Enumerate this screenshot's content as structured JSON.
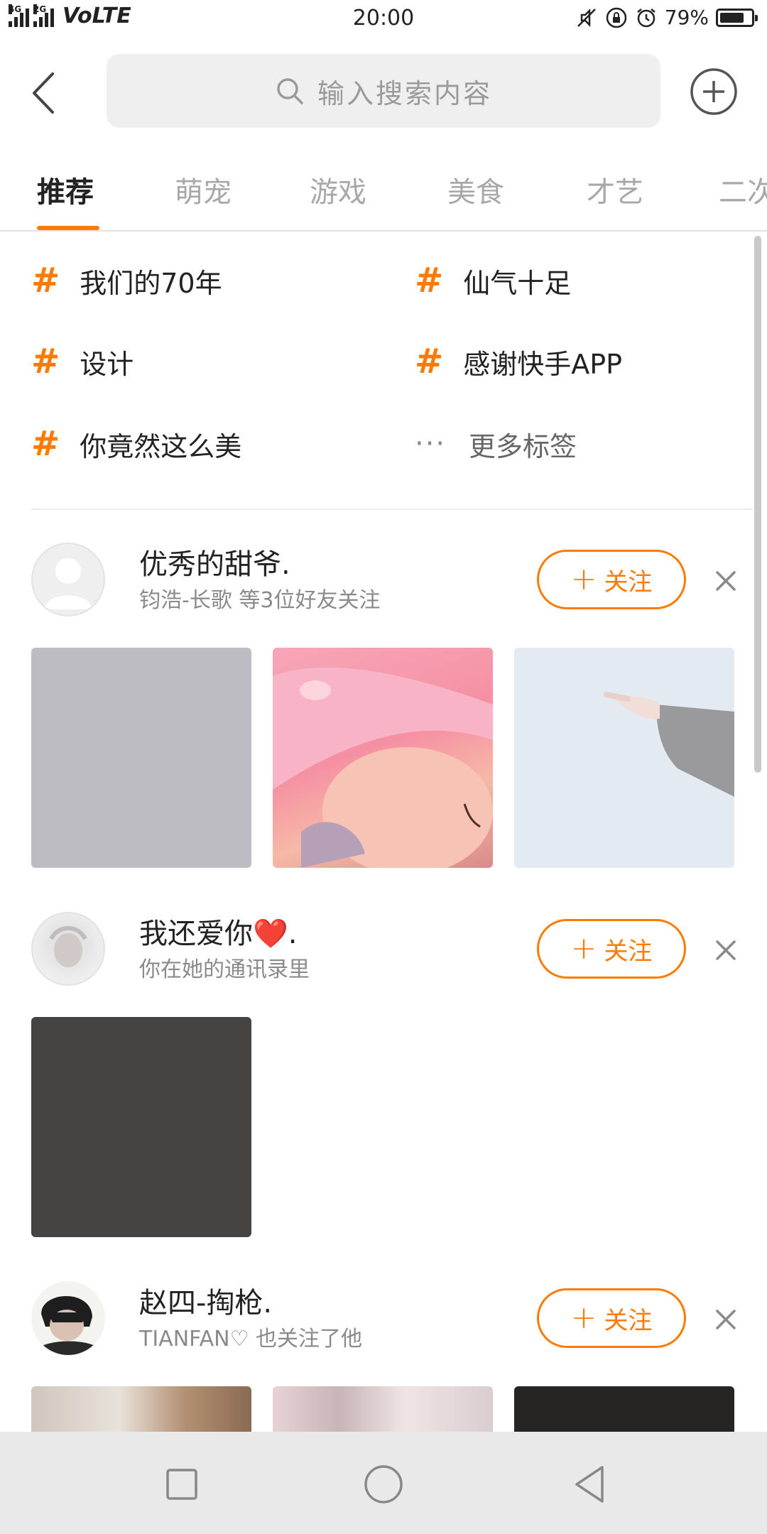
{
  "status_bar": {
    "network_small": "4G",
    "network_small2": "2G",
    "volte": "VoLTE",
    "time": "20:00",
    "battery_text": "79%",
    "battery_level": 0.79
  },
  "search": {
    "placeholder": "输入搜索内容"
  },
  "tabs": [
    "推荐",
    "萌宠",
    "游戏",
    "美食",
    "才艺",
    "二次"
  ],
  "tags": {
    "items": [
      "我们的70年",
      "仙气十足",
      "设计",
      "感谢快手APP",
      "你竟然这么美"
    ],
    "more_label": "更多标签"
  },
  "users": [
    {
      "name": "优秀的甜爷.",
      "subtitle": "钧浩-长歌 等3位好友关注",
      "follow_label": "关注",
      "thumbs": [
        "gray",
        "pink-blanket-baby",
        "pointing-hand"
      ]
    },
    {
      "name": "我还爱你❤️.",
      "subtitle": "你在她的通讯录里",
      "follow_label": "关注",
      "thumbs": [
        "dark"
      ]
    },
    {
      "name": "赵四-掏枪.",
      "subtitle": "TIANFAN♡ 也关注了他",
      "follow_label": "关注",
      "thumbs": [
        "room",
        "blanket",
        "black"
      ]
    }
  ],
  "colors": {
    "accent": "#ff7a00",
    "search_bg": "#efefef",
    "navbar_bg": "#e9e9e9"
  }
}
